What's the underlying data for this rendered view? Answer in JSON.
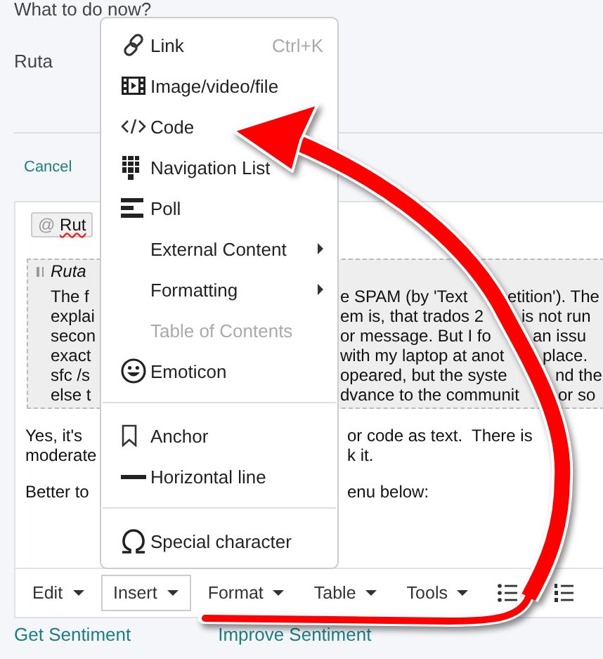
{
  "question": "What to do now?",
  "author": "Ruta",
  "cancel": "Cancel",
  "editor": {
    "mention": {
      "at": "@",
      "name": "Rut"
    },
    "quote": {
      "author": "Ruta",
      "lines": [
        {
          "left": "The f",
          "right": [
            "e SPAM (by 'Text",
            "etition'). The"
          ]
        },
        {
          "left": "explai",
          "right": [
            "em is, that trados 2",
            "is not run"
          ]
        },
        {
          "left": "secon",
          "right": [
            "or message. But I fo",
            "an issu"
          ]
        },
        {
          "left": "exact",
          "right": [
            "with my laptop at anot",
            "place."
          ]
        },
        {
          "left": "sfc /s",
          "right": [
            "opeared, but the syste",
            "nd the"
          ]
        },
        {
          "left": "else t",
          "right": [
            "dvance to the communit",
            "or so"
          ]
        }
      ]
    },
    "body": [
      {
        "left": "Yes, it's",
        "right": [
          "or code as text.  There is"
        ]
      },
      {
        "left": "moderate",
        "right": [
          "k it."
        ]
      },
      {
        "left": "Better to",
        "right": [
          "enu below:"
        ]
      }
    ],
    "toolbar": [
      {
        "label": "Edit",
        "selected": false
      },
      {
        "label": "Insert",
        "selected": true
      },
      {
        "label": "Format",
        "selected": false
      },
      {
        "label": "Table",
        "selected": false
      },
      {
        "label": "Tools",
        "selected": false
      }
    ]
  },
  "links": [
    "Get Sentiment",
    "Improve Sentiment"
  ],
  "menu": [
    {
      "kind": "item",
      "label": "Link",
      "shortcut": "Ctrl+K",
      "submenu": false,
      "disabled": false
    },
    {
      "kind": "item",
      "label": "Image/video/file",
      "submenu": false,
      "disabled": false
    },
    {
      "kind": "item",
      "label": "Code",
      "submenu": false,
      "disabled": false
    },
    {
      "kind": "item",
      "label": "Navigation List",
      "submenu": false,
      "disabled": false
    },
    {
      "kind": "item",
      "label": "Poll",
      "submenu": false,
      "disabled": false
    },
    {
      "kind": "item",
      "label": "External Content",
      "submenu": true,
      "disabled": false
    },
    {
      "kind": "item",
      "label": "Formatting",
      "submenu": true,
      "disabled": false
    },
    {
      "kind": "item",
      "label": "Table of Contents",
      "submenu": false,
      "disabled": true
    },
    {
      "kind": "item",
      "label": "Emoticon",
      "submenu": false,
      "disabled": false
    },
    {
      "kind": "divider"
    },
    {
      "kind": "item",
      "label": "Anchor",
      "submenu": false,
      "disabled": false
    },
    {
      "kind": "item",
      "label": "Horizontal line",
      "submenu": false,
      "disabled": false
    },
    {
      "kind": "divider"
    },
    {
      "kind": "item",
      "label": "Special character",
      "submenu": false,
      "disabled": false
    }
  ]
}
